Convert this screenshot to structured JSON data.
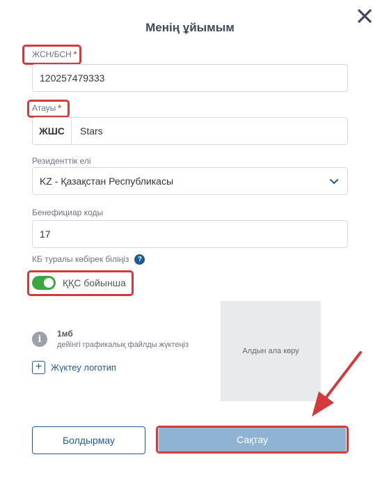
{
  "dialog": {
    "title": "Менің ұйымым"
  },
  "form": {
    "bin": {
      "label": "ЖСН/БСН",
      "required_mark": "*",
      "value": "120257479333"
    },
    "name": {
      "label": "Атауы",
      "required_mark": "*",
      "prefix": "ЖШС",
      "value": "Stars"
    },
    "residency": {
      "label": "Резиденттік елі",
      "value": "KZ - Қазақстан Республикасы"
    },
    "beneficiary": {
      "label": "Бенефициар коды",
      "value": "17"
    },
    "kb_help": {
      "label": "КБ туралы көбірек біліңіз",
      "icon": "?"
    },
    "vat_toggle": {
      "label": "ҚҚС бойынша",
      "on": true
    }
  },
  "logo": {
    "size_limit": "1мб",
    "hint": "дейінгі графикалық файлды жүктеңіз",
    "info_icon": "i",
    "upload_icon": "+",
    "upload_label": "Жүктеу логотип",
    "preview_label": "Алдын ала көру"
  },
  "actions": {
    "cancel_label": "Болдырмау",
    "save_label": "Сақтау"
  },
  "colors": {
    "accent": "#1f5a96",
    "highlight": "#d23b3b",
    "toggle_on": "#3aa842",
    "save_bg": "#8fb3d3"
  }
}
